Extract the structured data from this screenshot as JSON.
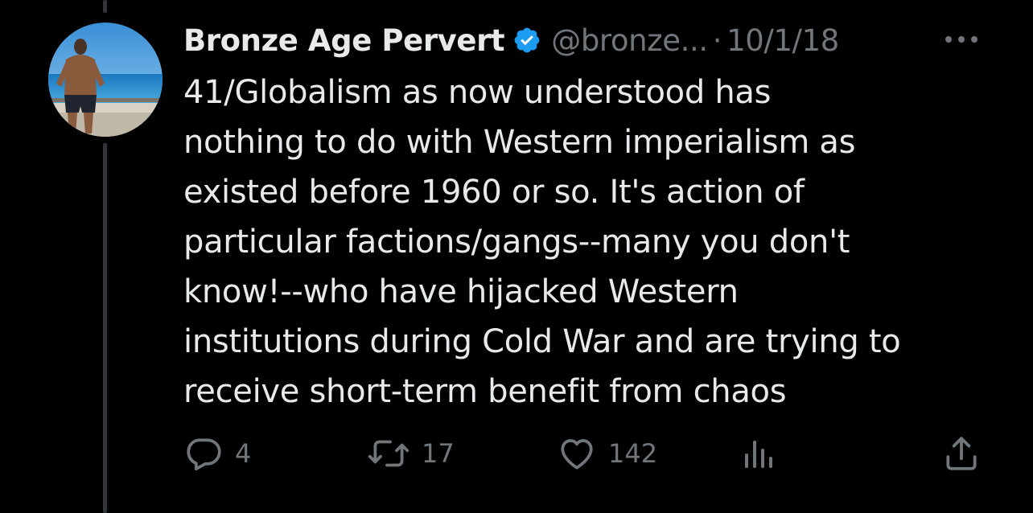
{
  "tweet": {
    "author": {
      "display_name": "Bronze Age Pervert",
      "handle": "@bronze...",
      "verified": true,
      "avatar_icon": "avatar-beach-photo"
    },
    "separator": "·",
    "date": "10/1/18",
    "text_lines": [
      "41/Globalism as now understood has",
      "nothing to do with Western imperialism as",
      "existed before 1960 or so. It's action of",
      "particular factions/gangs--many you don't",
      "know!--who have hijacked Western",
      "institutions during Cold War and are trying to",
      "receive short-term benefit from chaos"
    ],
    "actions": {
      "reply": {
        "icon": "reply-icon",
        "count": "4"
      },
      "retweet": {
        "icon": "retweet-icon",
        "count": "17"
      },
      "like": {
        "icon": "heart-icon",
        "count": "142"
      },
      "views": {
        "icon": "views-icon"
      },
      "share": {
        "icon": "share-icon"
      }
    },
    "more_icon": "more-icon"
  },
  "colors": {
    "background": "#000000",
    "text_primary": "#e7e9ea",
    "text_secondary": "#71767b",
    "verified_blue": "#1d9bf0",
    "thread_line": "#333639"
  }
}
